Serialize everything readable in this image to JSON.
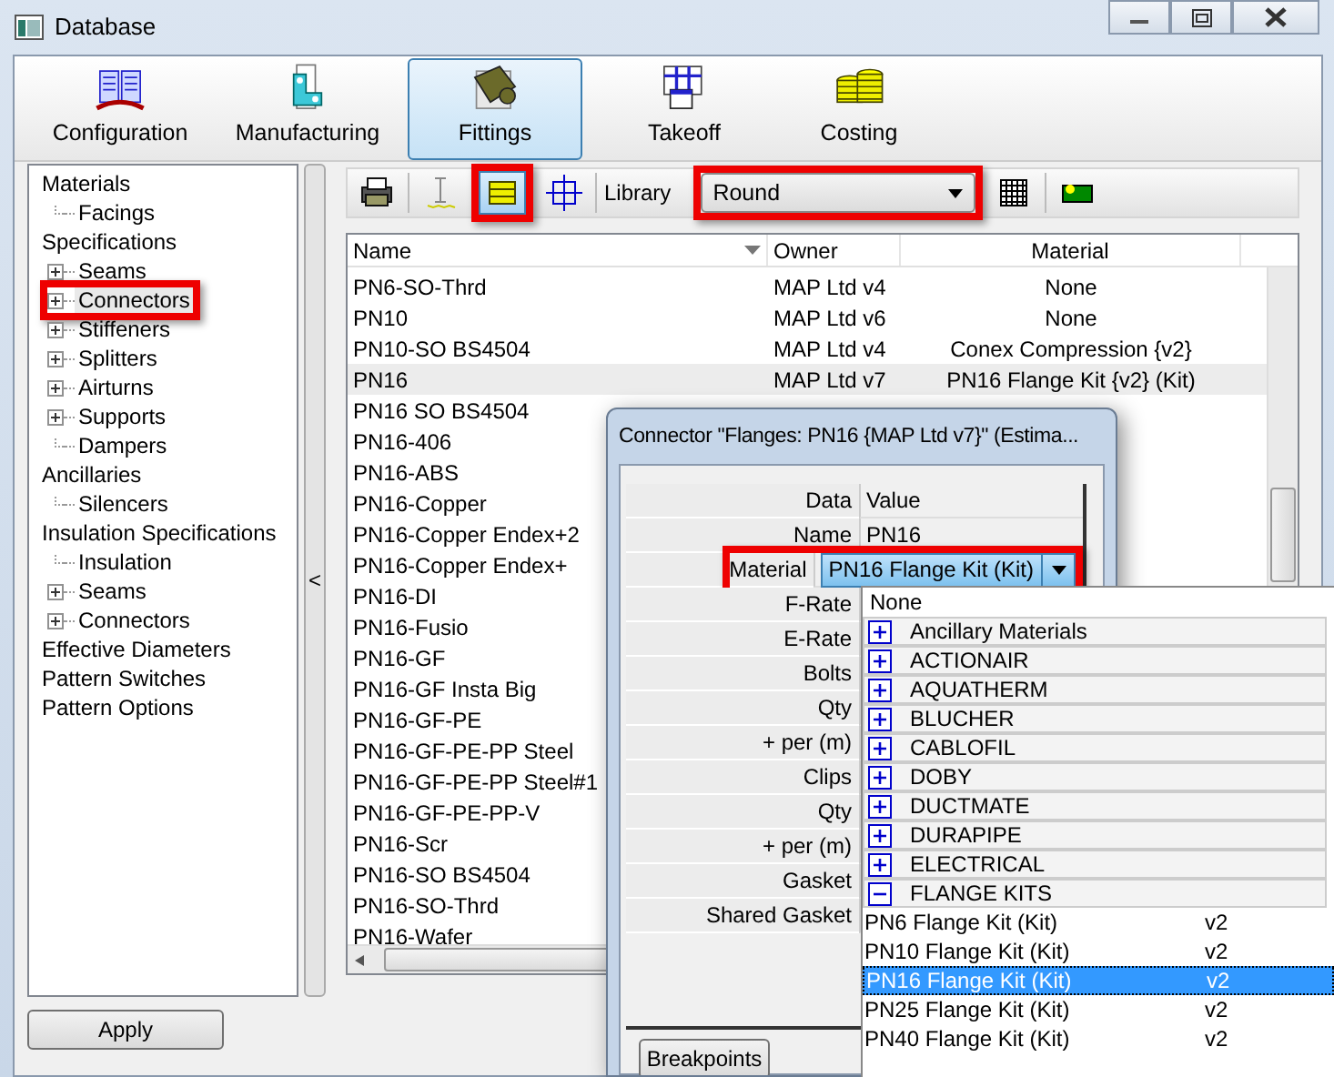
{
  "window": {
    "title": "Database"
  },
  "ribbon": [
    {
      "label": "Configuration",
      "kind": "config",
      "selected": false
    },
    {
      "label": "Manufacturing",
      "kind": "manufacturing",
      "selected": false
    },
    {
      "label": "Fittings",
      "kind": "fittings",
      "selected": true
    },
    {
      "label": "Takeoff",
      "kind": "takeoff",
      "selected": false
    },
    {
      "label": "Costing",
      "kind": "costing",
      "selected": false
    }
  ],
  "tree": [
    {
      "label": "Materials",
      "children": [
        {
          "label": "Facings"
        }
      ]
    },
    {
      "label": "Specifications",
      "children": [
        {
          "label": "Seams",
          "expanded": false
        },
        {
          "label": "Connectors",
          "expanded": false,
          "highlighted": true
        },
        {
          "label": "Stiffeners",
          "expanded": false
        },
        {
          "label": "Splitters",
          "expanded": false
        },
        {
          "label": "Airturns",
          "expanded": false
        },
        {
          "label": "Supports",
          "expanded": false
        },
        {
          "label": "Dampers"
        }
      ]
    },
    {
      "label": "Ancillaries",
      "children": [
        {
          "label": "Silencers"
        }
      ]
    },
    {
      "label": "Insulation Specifications",
      "children": [
        {
          "label": "Insulation"
        },
        {
          "label": "Seams",
          "expanded": false
        },
        {
          "label": "Connectors",
          "expanded": false
        }
      ]
    },
    {
      "label": "Effective Diameters"
    },
    {
      "label": "Pattern Switches"
    },
    {
      "label": "Pattern Options"
    }
  ],
  "splitter": {
    "glyph": "<"
  },
  "apply_button": "Apply",
  "toolbar": {
    "tools": [
      {
        "kind": "print",
        "selected": false,
        "highlighted": false
      },
      {
        "kind": "cursor",
        "selected": false,
        "highlighted": false
      },
      {
        "kind": "list",
        "selected": true,
        "highlighted": true
      },
      {
        "kind": "crosshair",
        "selected": false,
        "highlighted": false
      }
    ],
    "library_label": "Library",
    "library_value": "Round",
    "library_highlighted": true,
    "extra_tools": [
      {
        "kind": "grid"
      },
      {
        "kind": "flag"
      }
    ]
  },
  "table": {
    "columns": [
      {
        "label": "Name",
        "sorted": true
      },
      {
        "label": "Owner",
        "sorted": false
      },
      {
        "label": "Material",
        "sorted": false
      }
    ],
    "rows": [
      {
        "name": "PN6-SO-Thrd",
        "owner": "MAP Ltd v4",
        "material": "None",
        "selected": false
      },
      {
        "name": "PN10",
        "owner": "MAP Ltd v6",
        "material": "None",
        "selected": false
      },
      {
        "name": "PN10-SO BS4504",
        "owner": "MAP Ltd v4",
        "material": "Conex Compression {v2}",
        "selected": false
      },
      {
        "name": "PN16",
        "owner": "MAP Ltd v7",
        "material": "PN16 Flange Kit {v2} (Kit)",
        "selected": true
      },
      {
        "name": "PN16 SO BS4504",
        "selected": false
      },
      {
        "name": "PN16-406",
        "selected": false
      },
      {
        "name": "PN16-ABS",
        "selected": false
      },
      {
        "name": "PN16-Copper",
        "selected": false
      },
      {
        "name": "PN16-Copper Endex+2",
        "selected": false
      },
      {
        "name": "PN16-Copper Endex+",
        "selected": false
      },
      {
        "name": "PN16-DI",
        "selected": false
      },
      {
        "name": "PN16-Fusio",
        "selected": false
      },
      {
        "name": "PN16-GF",
        "selected": false
      },
      {
        "name": "PN16-GF Insta Big",
        "selected": false
      },
      {
        "name": "PN16-GF-PE",
        "selected": false
      },
      {
        "name": "PN16-GF-PE-PP Steel",
        "selected": false
      },
      {
        "name": "PN16-GF-PE-PP Steel#1",
        "selected": false
      },
      {
        "name": "PN16-GF-PE-PP-V",
        "selected": false
      },
      {
        "name": "PN16-Scr",
        "selected": false
      },
      {
        "name": "PN16-SO BS4504",
        "selected": false
      },
      {
        "name": "PN16-SO-Thrd",
        "selected": false
      },
      {
        "name": "PN16-Wafer",
        "selected": false
      }
    ]
  },
  "dialog": {
    "title": "Connector \"Flanges: PN16 {MAP Ltd v7}\" (Estima...",
    "grid_header": [
      "Data",
      "Value"
    ],
    "properties": [
      {
        "label": "Name",
        "kind": "text",
        "value": "PN16"
      },
      {
        "label": "Material",
        "kind": "combo",
        "value": "PN16 Flange Kit (Kit)",
        "highlighted": true
      },
      {
        "label": "F-Rate",
        "kind": "hidden"
      },
      {
        "label": "E-Rate",
        "kind": "hidden"
      },
      {
        "label": "Bolts",
        "kind": "hidden"
      },
      {
        "label": "Qty",
        "kind": "hidden"
      },
      {
        "label": "+ per (m)",
        "kind": "hidden"
      },
      {
        "label": "Clips",
        "kind": "hidden"
      },
      {
        "label": "Qty",
        "kind": "hidden"
      },
      {
        "label": "+ per (m)",
        "kind": "hidden"
      },
      {
        "label": "Gasket",
        "kind": "hidden"
      },
      {
        "label": "Shared Gasket",
        "kind": "hidden"
      }
    ],
    "button": "Breakpoints"
  },
  "dropdown": [
    {
      "kind": "option",
      "label": "None",
      "selected": false
    },
    {
      "kind": "group",
      "label": "Ancillary Materials",
      "expanded": false
    },
    {
      "kind": "group",
      "label": "ACTIONAIR",
      "expanded": false
    },
    {
      "kind": "group",
      "label": "AQUATHERM",
      "expanded": false
    },
    {
      "kind": "group",
      "label": "BLUCHER",
      "expanded": false
    },
    {
      "kind": "group",
      "label": "CABLOFIL",
      "expanded": false
    },
    {
      "kind": "group",
      "label": "DOBY",
      "expanded": false
    },
    {
      "kind": "group",
      "label": "DUCTMATE",
      "expanded": false
    },
    {
      "kind": "group",
      "label": "DURAPIPE",
      "expanded": false
    },
    {
      "kind": "group",
      "label": "ELECTRICAL",
      "expanded": false
    },
    {
      "kind": "group",
      "label": "FLANGE KITS",
      "expanded": true
    },
    {
      "kind": "item",
      "label": "PN6 Flange Kit (Kit)",
      "version": "v2",
      "selected": false
    },
    {
      "kind": "item",
      "label": "PN10 Flange Kit (Kit)",
      "version": "v2",
      "selected": false
    },
    {
      "kind": "item",
      "label": "PN16 Flange Kit (Kit)",
      "version": "v2",
      "selected": true
    },
    {
      "kind": "item",
      "label": "PN25 Flange Kit (Kit)",
      "version": "v2",
      "selected": false
    },
    {
      "kind": "item",
      "label": "PN40 Flange Kit (Kit)",
      "version": "v2",
      "selected": false
    }
  ]
}
